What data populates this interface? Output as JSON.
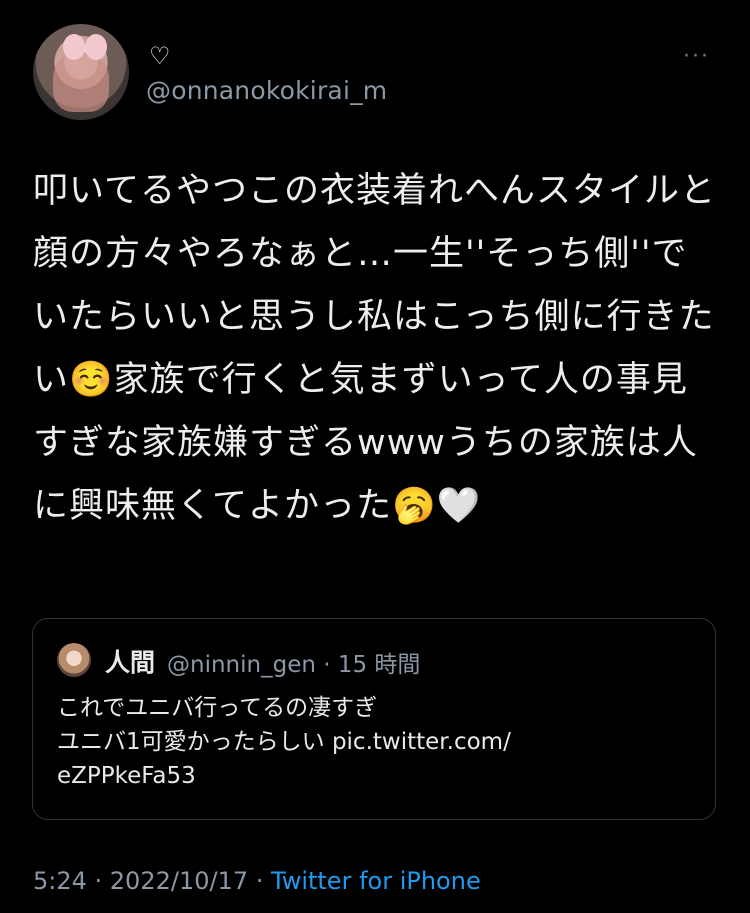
{
  "header": {
    "display_name": "♡",
    "handle": "@onnanokokirai_m",
    "more_label": "···"
  },
  "tweet": {
    "text": "叩いてるやつこの衣装着れへんスタイルと顔の方々やろなぁと…一生''そっち側''でいたらいいと思うし私はこっち側に行きたい☺️家族で行くと気まずいって人の事見すぎな家族嫌すぎるwwwうちの家族は人に興味無くてよかった🥱🤍"
  },
  "quote": {
    "name": "人間",
    "meta": "@ninnin_gen · 15 時間",
    "text_line1": "これでユニバ行ってるの凄すぎ",
    "text_line2": "ユニバ1可愛かったらしい pic.twitter.com/",
    "text_line3": "eZPPkeFa53"
  },
  "footer": {
    "time_date": "5:24 · 2022/10/17 · ",
    "app": "Twitter for iPhone"
  },
  "colors": {
    "background": "#000000",
    "text": "#e7e9ea",
    "muted": "#8b98a5",
    "link": "#1d9bf0",
    "border": "#2f3336"
  }
}
